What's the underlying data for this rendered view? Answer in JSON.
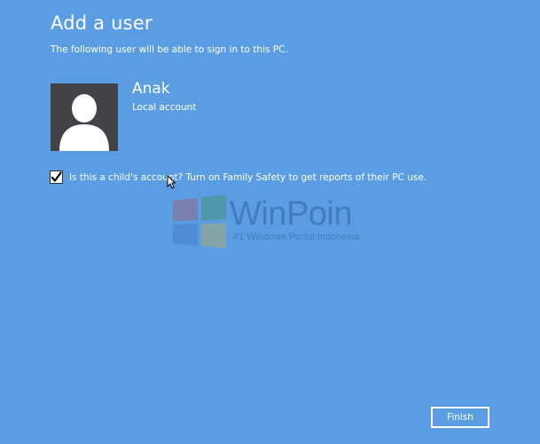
{
  "dialog": {
    "title": "Add a user",
    "subtitle": "The following user will be able to sign in to this PC."
  },
  "user": {
    "name": "Anak",
    "account_type": "Local account",
    "avatar_icon": "user-silhouette-icon"
  },
  "family_safety": {
    "checked": true,
    "label": "Is this a child's account? Turn on Family Safety to get reports of their PC use."
  },
  "watermark": {
    "title": "WinPoin",
    "tagline": "#1 Windows Portal Indonesia"
  },
  "actions": {
    "finish_label": "Finish"
  },
  "colors": {
    "background": "#5a9de3",
    "avatar_bg": "#434347",
    "text": "#ffffff"
  }
}
